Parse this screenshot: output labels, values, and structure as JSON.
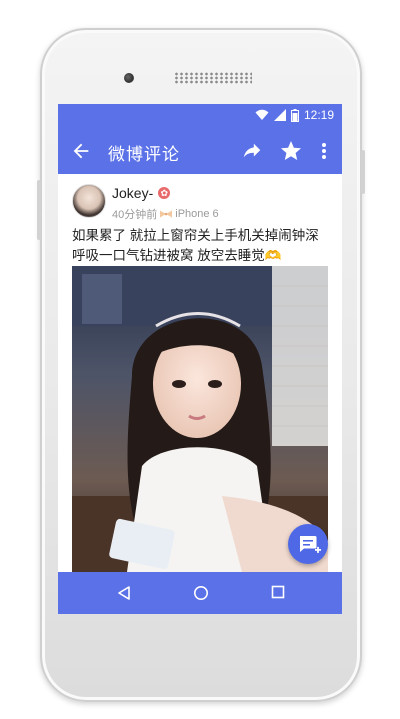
{
  "status_bar": {
    "time": "12:19"
  },
  "toolbar": {
    "title": "微博评论"
  },
  "post": {
    "author": "Jokey-",
    "time_ago": "40分钟前",
    "source": "iPhone 6",
    "text": "如果累了 就拉上窗帘关上手机关掉闹钟深呼吸一口气钻进被窝 放空去睡觉",
    "text_emoji": "🫶"
  },
  "colors": {
    "primary": "#5b71e8",
    "fab": "#4f69e6",
    "badge": "#e86a6a"
  },
  "icons": {
    "back": "arrow-left-icon",
    "share": "share-icon",
    "star": "star-icon",
    "more": "more-vertical-icon",
    "fab": "comment-add-icon",
    "nav_back": "triangle-back-icon",
    "nav_home": "circle-home-icon",
    "nav_recent": "square-recent-icon"
  }
}
